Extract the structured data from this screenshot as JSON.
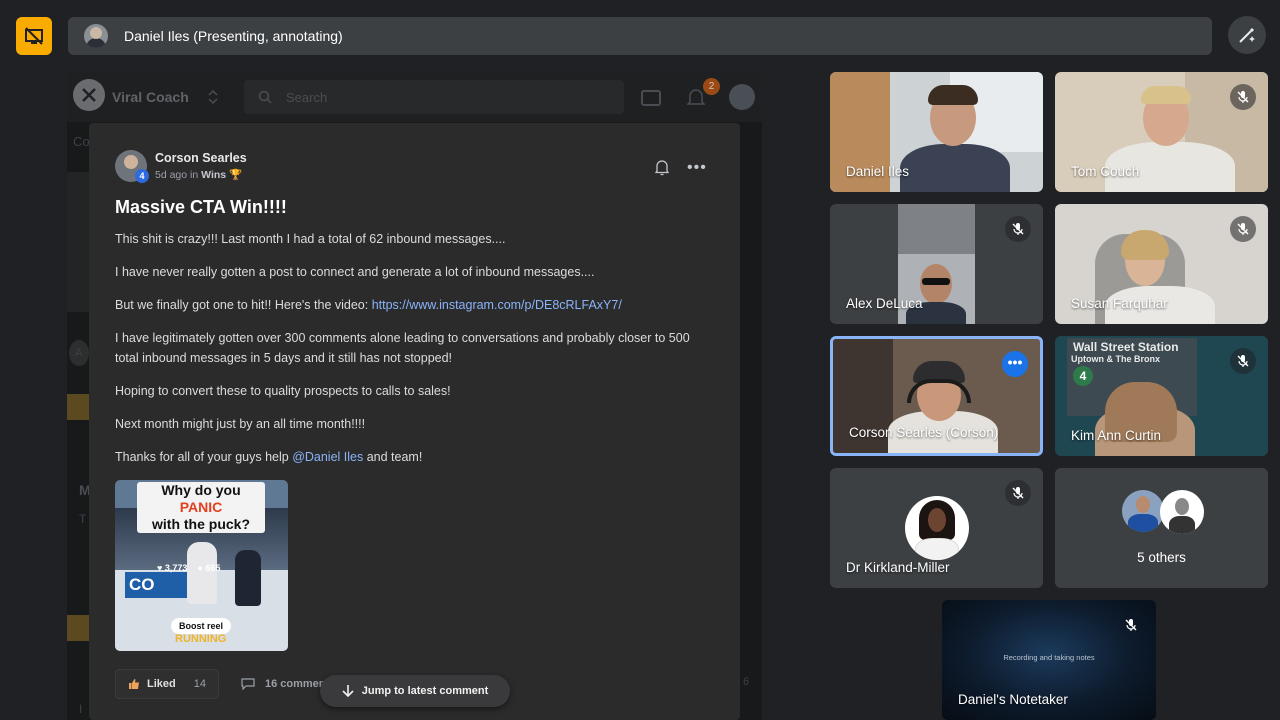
{
  "meet": {
    "presenter_text": "Daniel Iles (Presenting, annotating)",
    "icons": {
      "stop": "stop-presenting-icon",
      "annotate": "annotate-pen-icon"
    },
    "accent": "#f9ab00"
  },
  "shared_app": {
    "title": "Viral Coach",
    "search_placeholder": "Search",
    "notification_count": "2",
    "side_text_1": "Co",
    "side_text_2": "M",
    "side_text_3": "T",
    "side_text_4": "I",
    "side_avatar_letter": "A",
    "side_number": "6"
  },
  "post": {
    "author": "Corson Searles",
    "level": "4",
    "time": "5d ago in ",
    "category": "Wins 🏆",
    "title": "Massive CTA Win!!!!",
    "p1": "This shit is crazy!!! Last month I had a total of 62 inbound messages....",
    "p2": "I have never really gotten a post to connect and generate a lot of inbound messages....",
    "p3_text": "But we finally got one to hit!! Here's the video: ",
    "p3_link": "https://www.instagram.com/p/DE8cRLFAxY7/",
    "p4": "I have legitimately gotten over 300 comments alone leading to conversations and probably closer to 500 total inbound messages in 5 days and it still has not stopped!",
    "p5": "Hoping to convert these to quality prospects to calls to sales!",
    "p6": "Next month might just by an all time month!!!!",
    "p7_text": "Thanks for all of your guys help ",
    "p7_mention": "@Daniel Iles",
    "p7_end": " and team!",
    "video": {
      "caption_1": "Why do you ",
      "caption_hl": "PANIC",
      "caption_2": "with the puck?",
      "likes": "3,773",
      "comments": "665",
      "ad_text": "CO",
      "boost": "Boost reel",
      "running": "RUNNING"
    },
    "liked_label": "Liked",
    "like_count": "14",
    "comment_count": "16 comments",
    "jump_label": "Jump to latest comment"
  },
  "participants": [
    {
      "name": "Daniel Iles",
      "muted": false
    },
    {
      "name": "Tom Couch",
      "muted": true
    },
    {
      "name": "Alex DeLuca",
      "muted": true
    },
    {
      "name": "Susan Farquhar",
      "muted": true
    },
    {
      "name": "Corson Searles (Corson)",
      "muted": false,
      "speaking": true
    },
    {
      "name": "Kim Ann Curtin",
      "muted": true
    },
    {
      "name": "Dr Kirkland-Miller",
      "muted": true
    },
    {
      "name": "5 others",
      "muted": false
    },
    {
      "name": "Daniel's Notetaker",
      "muted": true,
      "status": "Recording and taking notes"
    }
  ],
  "tile_backgrounds": {
    "kim_wall_sign_1": "Wall Street Station",
    "kim_wall_sign_2": "Uptown & The Bronx",
    "kim_wall_sign_3": "4"
  }
}
